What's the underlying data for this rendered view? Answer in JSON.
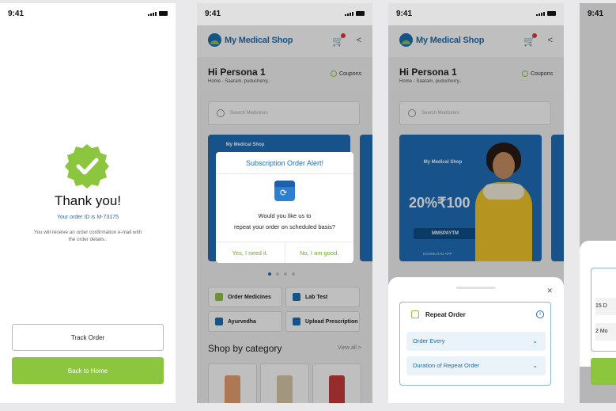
{
  "status": {
    "time": "9:41"
  },
  "screen1": {
    "title": "Thank you!",
    "order_id": "Your order ID is M-73175",
    "confirmation": "You will receive an order confirmation e-mail with the order details..",
    "track_label": "Track Order",
    "home_label": "Back to Home"
  },
  "shop": {
    "brand": "My Medical Shop",
    "greeting": "Hi Persona 1",
    "location": "Home - Saaram, puducherry..",
    "coupons": "Coupons",
    "search_placeholder": "Search Medicines",
    "banner": {
      "brand": "My Medical Shop",
      "percent": "20%",
      "amount": "₹100",
      "code": "MMSPAYTM",
      "download": "DOWNLOAD APP"
    },
    "quick_links": [
      "Order Medicines",
      "Lab Test",
      "Ayurvedha",
      "Upload Prescription"
    ],
    "section_title": "Shop by category",
    "view_all": "View all >"
  },
  "alert": {
    "title": "Subscription Order Alert!",
    "message_line1": "Would you like us to",
    "message_line2": "repeat your order on scheduled basis?",
    "yes_label": "Yes, I need it.",
    "no_label": "No, I am good."
  },
  "repeat_sheet": {
    "title": "Repeat Order",
    "order_every": "Order Every",
    "duration": "Duration of Repeat Order"
  },
  "screen4": {
    "row1": "15 D",
    "row2": "2 Mo"
  },
  "colors": {
    "primary": "#1e6fb3",
    "accent": "#8cc63f"
  }
}
